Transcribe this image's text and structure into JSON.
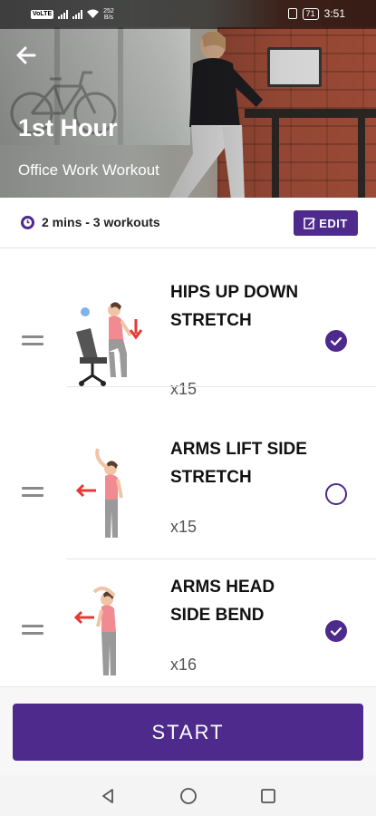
{
  "status_bar": {
    "net_badge": "VoLTE",
    "speed_value": "252",
    "speed_unit": "B/s",
    "battery": "71",
    "time": "3:51"
  },
  "header": {
    "title": "1st Hour",
    "subtitle": "Office Work Workout",
    "back_icon": "arrow-left-icon"
  },
  "info": {
    "duration": "2 mins - 3 workouts",
    "edit_label": "EDIT"
  },
  "exercises": [
    {
      "name": "HIPS UP DOWN STRETCH",
      "reps": "x15",
      "checked": true
    },
    {
      "name": "ARMS LIFT SIDE STRETCH",
      "reps": "x15",
      "checked": false
    },
    {
      "name": "ARMS HEAD SIDE BEND",
      "reps": "x16",
      "checked": true
    }
  ],
  "start_label": "START",
  "colors": {
    "accent": "#4d2a8b"
  }
}
